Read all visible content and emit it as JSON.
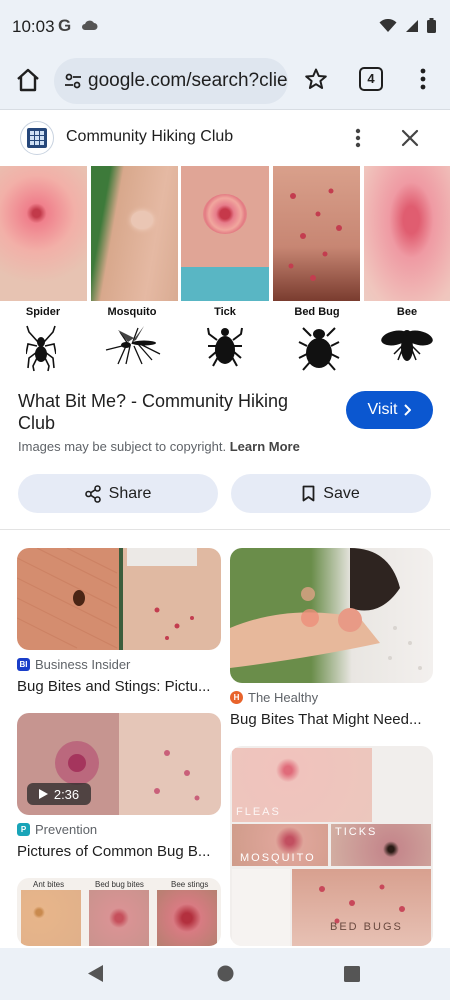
{
  "status_bar": {
    "time": "10:03",
    "g_label": "G"
  },
  "toolbar": {
    "url": "google.com/search?clier",
    "tab_count": "4"
  },
  "source": {
    "name": "Community Hiking Club"
  },
  "hero": {
    "labels": [
      "Spider",
      "Mosquito",
      "Tick",
      "Bed Bug",
      "Bee"
    ]
  },
  "result": {
    "title": "What Bit Me? - Community Hiking Club",
    "visit_label": "Visit",
    "copyright_text": "Images may be subject to copyright.",
    "learn_more": "Learn More",
    "share_label": "Share",
    "save_label": "Save"
  },
  "related": [
    {
      "source": "Business Insider",
      "fav": "BI",
      "fav_color": "#1a3ec9",
      "title": "Bug Bites and Stings: Pictu..."
    },
    {
      "source": "The Healthy",
      "fav": "H",
      "fav_color": "#e8632b",
      "title": "Bug Bites That Might Need..."
    },
    {
      "source": "Prevention",
      "fav": "P",
      "fav_color": "#19a4b8",
      "title": "Pictures of Common Bug B...",
      "duration": "2:36"
    },
    {
      "labels": [
        "Ant bites",
        "Bed bug bites",
        "Bee stings"
      ]
    },
    {
      "labels": [
        "FLEAS",
        "TICKS",
        "MOSQUITO",
        "BED BUGS"
      ]
    }
  ],
  "colors": {
    "accent": "#0b57d0",
    "chrome_bg": "#ecf1f7",
    "pill_bg": "#e6ebf6"
  }
}
